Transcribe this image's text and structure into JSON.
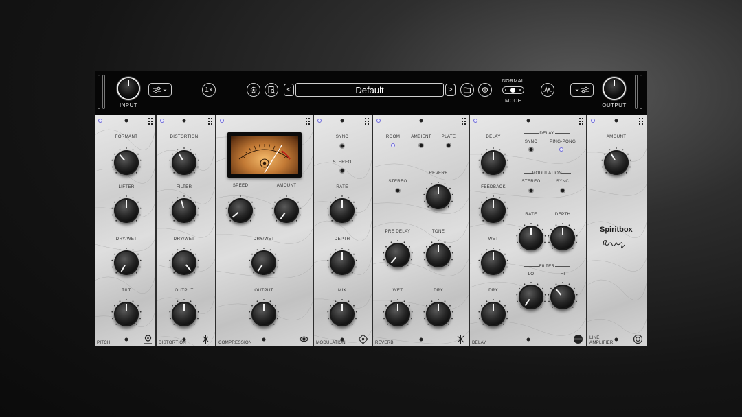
{
  "header": {
    "input_label": "INPUT",
    "output_label": "OUTPUT",
    "oversample_label": "1×",
    "preset_name": "Default",
    "mode_value": "NORMAL",
    "mode_label": "MODE",
    "prev_label": "<",
    "next_label": ">"
  },
  "panels": {
    "pitch": {
      "name": "PITCH",
      "params": [
        "FORMANT",
        "LIFTER",
        "DRY/WET",
        "TILT"
      ]
    },
    "distortion": {
      "name": "DISTORTION",
      "params": [
        "DISTORTION",
        "FILTER",
        "DRY/WET",
        "OUTPUT"
      ]
    },
    "compression": {
      "name": "COMPRESSION",
      "params": [
        "SPEED",
        "AMOUNT",
        "DRY/WET",
        "OUTPUT"
      ]
    },
    "modulation": {
      "name": "MODULATION",
      "params": [
        "SYNC",
        "STEREO",
        "RATE",
        "DEPTH",
        "MIX"
      ]
    },
    "reverb": {
      "name": "REVERB",
      "params": [
        "ROOM",
        "AMBIENT",
        "PLATE",
        "STEREO",
        "REVERB",
        "PRE DELAY",
        "TONE",
        "WET",
        "DRY"
      ]
    },
    "delay": {
      "name": "DELAY",
      "params": [
        "DELAY",
        "FEEDBACK",
        "WET",
        "DRY"
      ],
      "delay_section": "DELAY",
      "sync": "SYNC",
      "ping_pong": "PING-PONG",
      "mod_section": "MODULATION",
      "mod_stereo": "STEREO",
      "mod_sync": "SYNC",
      "rate": "RATE",
      "depth": "DEPTH",
      "filter_section": "FILTER",
      "lo": "LO",
      "hi": "HI"
    },
    "line_amplifier": {
      "name": "LINE AMPLIFIER",
      "params": [
        "AMOUNT"
      ],
      "brand": "Spiritbox"
    }
  },
  "icons": [
    "sliders-icon",
    "gear-icon",
    "preset-browser-icon",
    "folder-icon",
    "random-icon",
    "waveform-icon"
  ],
  "colors": {
    "led": "#6e6ad8",
    "header_bg": "#060606",
    "panel": "#d6d6d6"
  }
}
